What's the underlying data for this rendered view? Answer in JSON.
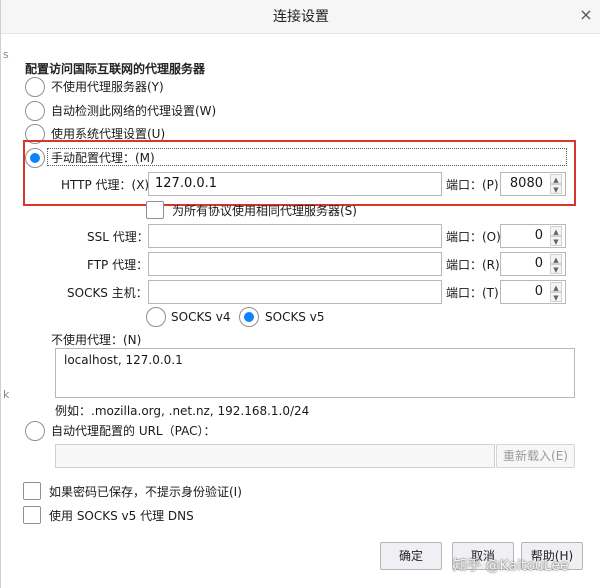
{
  "window": {
    "title": "连接设置",
    "close_glyph": "×"
  },
  "section_title": "配置访问国际互联网的代理服务器",
  "proxy_modes": [
    {
      "label": "不使用代理服务器(Y)",
      "checked": false
    },
    {
      "label": "自动检测此网络的代理设置(W)",
      "checked": false
    },
    {
      "label": "使用系统代理设置(U)",
      "checked": false
    },
    {
      "label": "手动配置代理：(M)",
      "checked": true
    }
  ],
  "http": {
    "label": "HTTP 代理：(X)",
    "value": "127.0.0.1",
    "port_label": "端口：(P)",
    "port": "8080"
  },
  "share_all": {
    "label": "为所有协议使用相同代理服务器(S)",
    "checked": false
  },
  "ssl": {
    "label": "SSL 代理：",
    "value": "",
    "port_label": "端口：(O)",
    "port": "0"
  },
  "ftp": {
    "label": "FTP 代理：",
    "value": "",
    "port_label": "端口：(R)",
    "port": "0"
  },
  "socks": {
    "label": "SOCKS 主机：",
    "value": "",
    "port_label": "端口：(T)",
    "port": "0"
  },
  "socks_version": {
    "v4": "SOCKS v4",
    "v5": "SOCKS v5",
    "selected": "v5"
  },
  "no_proxy": {
    "label": "不使用代理：(N)",
    "value": "localhost, 127.0.0.1",
    "example": "例如：.mozilla.org, .net.nz, 192.168.1.0/24"
  },
  "auto_config": {
    "label": "自动代理配置的 URL（PAC）：",
    "value": "",
    "reload_label": "重新载入(E)"
  },
  "options": [
    {
      "label": "如果密码已保存，不提示身份验证(I)",
      "checked": false
    },
    {
      "label": "使用 SOCKS v5 代理 DNS",
      "checked": false
    }
  ],
  "buttons": {
    "ok": "确定",
    "cancel": "取消",
    "help": "帮助(H)"
  },
  "spinner": {
    "up": "▲",
    "down": "▼"
  },
  "watermark": "知乎 @KaitouLee",
  "colors": {
    "accent": "#0a84ff",
    "highlight_box": "#d9362b"
  }
}
